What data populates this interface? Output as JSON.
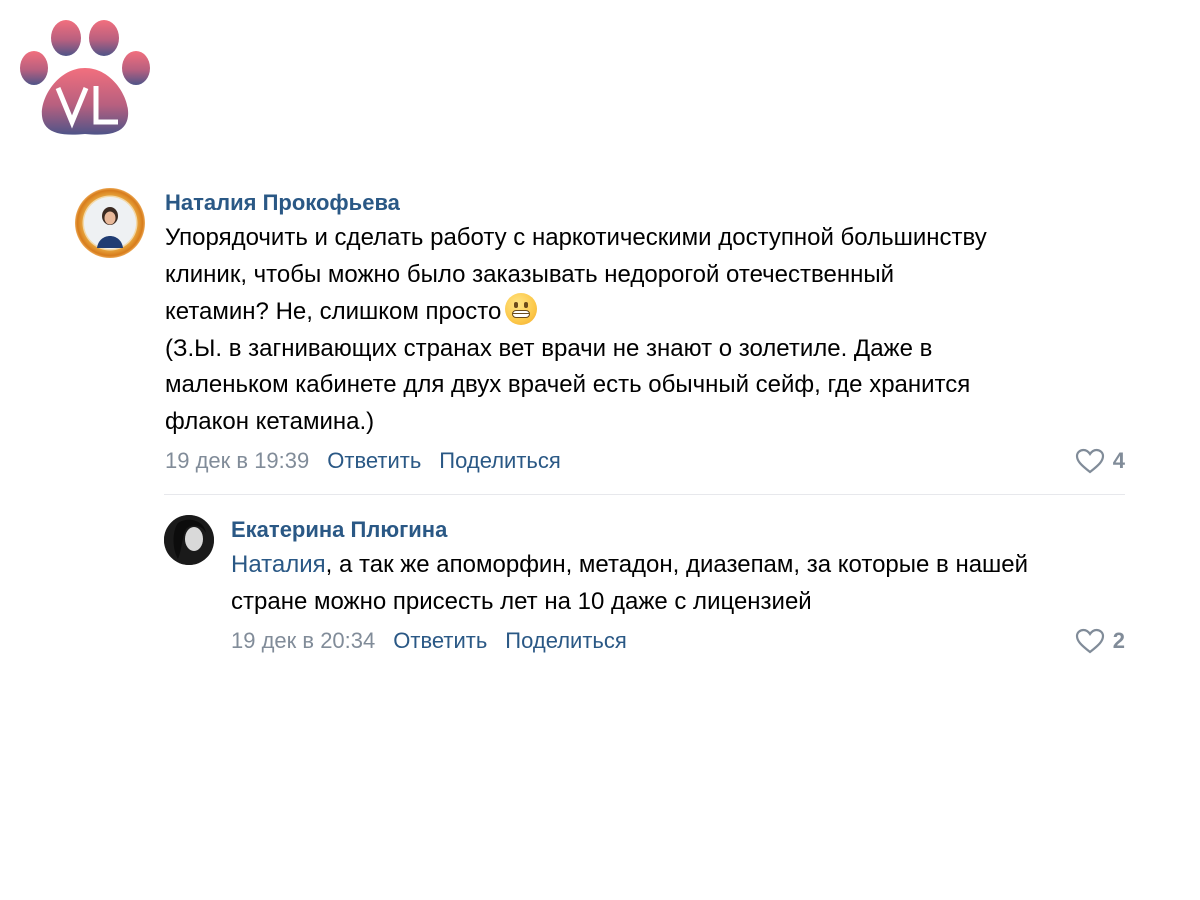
{
  "logo": {
    "text": "VL",
    "colors": [
      "#f06a7c",
      "#5a5a8e"
    ]
  },
  "comments": [
    {
      "author": "Наталия Прокофьева",
      "text_lines": [
        "Упорядочить и сделать работу с наркотическими доступной большинству",
        "клиник, чтобы можно было заказывать недорогой отечественный",
        "кетамин? Не, слишком просто"
      ],
      "emoji": "grimacing-face-emoji",
      "text_lines_2": [
        "(З.Ы. в загнивающих странах вет врачи не знают о золетиле. Даже в",
        "маленьком кабинете для двух врачей есть обычный сейф, где хранится",
        "флакон кетамина.)"
      ],
      "date": "19 дек в 19:39",
      "reply_label": "Ответить",
      "share_label": "Поделиться",
      "likes": "4"
    },
    {
      "author": "Екатерина Плюгина",
      "mention": "Наталия",
      "text_rest": ", а так же апоморфин, метадон, диазепам, за которые в нашей",
      "text_line_2": "стране можно присесть лет на 10 даже с лицензией",
      "date": "19 дек в 20:34",
      "reply_label": "Ответить",
      "share_label": "Поделиться",
      "likes": "2"
    }
  ],
  "colors": {
    "link": "#2a5885",
    "meta": "#818c99",
    "divider": "#e7e8ec"
  }
}
